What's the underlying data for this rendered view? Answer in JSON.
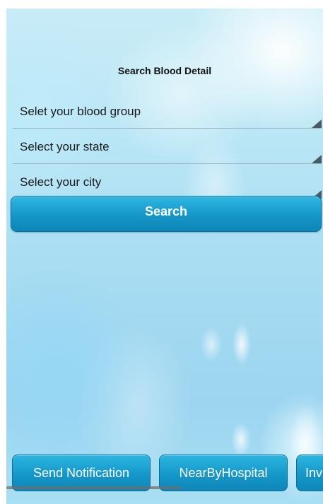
{
  "page": {
    "title": "Search Blood Detail"
  },
  "form": {
    "blood_group": {
      "label": "Selet your blood group",
      "icon": "dropdown-triangle-icon"
    },
    "state": {
      "label": "Select your state",
      "icon": "dropdown-triangle-icon"
    },
    "city": {
      "label": "Select your city",
      "icon": "dropdown-triangle-icon"
    },
    "search_label": "Search"
  },
  "bottom_bar": {
    "items": [
      {
        "label": "Send Notification"
      },
      {
        "label": "NearByHospital"
      },
      {
        "label": "Inv"
      }
    ]
  },
  "colors": {
    "button_accent": "#1596c8",
    "button_text": "#ffffff",
    "background": "#b7e5f5"
  }
}
